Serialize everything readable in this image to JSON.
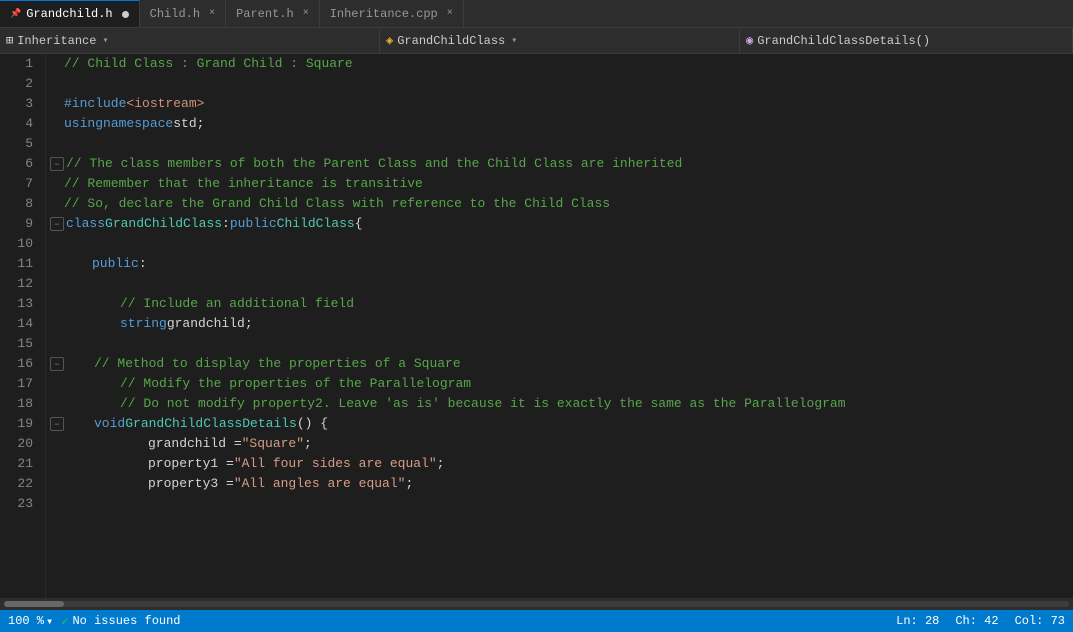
{
  "tabs": [
    {
      "id": "grandchild-h",
      "label": "Grandchild.h",
      "active": true,
      "modified": true,
      "pinned": true
    },
    {
      "id": "child-h",
      "label": "Child.h",
      "active": false,
      "modified": false
    },
    {
      "id": "parent-h",
      "label": "Parent.h",
      "active": false,
      "modified": false
    },
    {
      "id": "inheritance-cpp",
      "label": "Inheritance.cpp",
      "active": false,
      "modified": false
    }
  ],
  "toolbar": {
    "scope_icon": "⊞",
    "scope_label": "Inheritance",
    "class_icon": "◈",
    "class_label": "GrandChildClass",
    "method_icon": "◉",
    "method_label": "GrandChildClassDetails()"
  },
  "lines": [
    {
      "num": 1,
      "indent": 0,
      "collapse": false,
      "content": [
        {
          "cls": "c-comment",
          "text": "// Child Class : Grand Child : Square"
        }
      ]
    },
    {
      "num": 2,
      "indent": 0,
      "collapse": false,
      "content": []
    },
    {
      "num": 3,
      "indent": 0,
      "collapse": false,
      "content": [
        {
          "cls": "c-keyword",
          "text": "#include"
        },
        {
          "cls": "c-default",
          "text": " "
        },
        {
          "cls": "c-include-path",
          "text": "<iostream>"
        }
      ]
    },
    {
      "num": 4,
      "indent": 0,
      "collapse": false,
      "content": [
        {
          "cls": "c-keyword",
          "text": "using"
        },
        {
          "cls": "c-default",
          "text": " "
        },
        {
          "cls": "c-keyword",
          "text": "namespace"
        },
        {
          "cls": "c-default",
          "text": " std;"
        }
      ]
    },
    {
      "num": 5,
      "indent": 0,
      "collapse": false,
      "content": []
    },
    {
      "num": 6,
      "indent": 0,
      "collapse": true,
      "content": [
        {
          "cls": "c-comment",
          "text": "// The class members of both the Parent Class and the Child Class are inherited"
        }
      ]
    },
    {
      "num": 7,
      "indent": 0,
      "collapse": false,
      "content": [
        {
          "cls": "c-comment",
          "text": "// Remember that the inheritance is transitive"
        }
      ]
    },
    {
      "num": 8,
      "indent": 0,
      "collapse": false,
      "content": [
        {
          "cls": "c-comment",
          "text": "// So, declare the Grand Child Class with reference to the Child Class"
        }
      ]
    },
    {
      "num": 9,
      "indent": 0,
      "collapse": true,
      "content": [
        {
          "cls": "c-keyword",
          "text": "class"
        },
        {
          "cls": "c-default",
          "text": " "
        },
        {
          "cls": "c-class-name",
          "text": "GrandChildClass"
        },
        {
          "cls": "c-default",
          "text": " : "
        },
        {
          "cls": "c-keyword",
          "text": "public"
        },
        {
          "cls": "c-default",
          "text": " "
        },
        {
          "cls": "c-class-name",
          "text": "ChildClass"
        },
        {
          "cls": "c-default",
          "text": " {"
        }
      ]
    },
    {
      "num": 10,
      "indent": 0,
      "collapse": false,
      "content": []
    },
    {
      "num": 11,
      "indent": 1,
      "collapse": false,
      "content": [
        {
          "cls": "c-public",
          "text": "public"
        },
        {
          "cls": "c-default",
          "text": ":"
        }
      ]
    },
    {
      "num": 12,
      "indent": 0,
      "collapse": false,
      "content": []
    },
    {
      "num": 13,
      "indent": 2,
      "collapse": false,
      "content": [
        {
          "cls": "c-comment",
          "text": "// Include an additional field"
        }
      ]
    },
    {
      "num": 14,
      "indent": 2,
      "collapse": false,
      "content": [
        {
          "cls": "c-keyword",
          "text": "string"
        },
        {
          "cls": "c-default",
          "text": " grandchild;"
        }
      ]
    },
    {
      "num": 15,
      "indent": 0,
      "collapse": false,
      "content": []
    },
    {
      "num": 16,
      "indent": 1,
      "collapse": true,
      "content": [
        {
          "cls": "c-comment",
          "text": "// Method to display the properties of a Square"
        }
      ]
    },
    {
      "num": 17,
      "indent": 2,
      "collapse": false,
      "content": [
        {
          "cls": "c-comment",
          "text": "// Modify the properties of the Parallelogram"
        }
      ]
    },
    {
      "num": 18,
      "indent": 2,
      "collapse": false,
      "content": [
        {
          "cls": "c-comment",
          "text": "// Do not modify property2. Leave 'as is' because it is exactly the same as the Parallelogram"
        }
      ]
    },
    {
      "num": 19,
      "indent": 1,
      "collapse": true,
      "content": [
        {
          "cls": "c-keyword",
          "text": "void"
        },
        {
          "cls": "c-default",
          "text": " "
        },
        {
          "cls": "c-class-name",
          "text": "GrandChildClassDetails"
        },
        {
          "cls": "c-default",
          "text": "() {"
        }
      ]
    },
    {
      "num": 20,
      "indent": 3,
      "collapse": false,
      "content": [
        {
          "cls": "c-default",
          "text": "grandchild = "
        },
        {
          "cls": "c-string",
          "text": "\"Square\""
        },
        {
          "cls": "c-default",
          "text": ";"
        }
      ]
    },
    {
      "num": 21,
      "indent": 3,
      "collapse": false,
      "content": [
        {
          "cls": "c-default",
          "text": "property1 = "
        },
        {
          "cls": "c-string",
          "text": "\"All four sides are equal\""
        },
        {
          "cls": "c-default",
          "text": ";"
        }
      ]
    },
    {
      "num": 22,
      "indent": 3,
      "collapse": false,
      "content": [
        {
          "cls": "c-default",
          "text": "property3 = "
        },
        {
          "cls": "c-string",
          "text": "\"All angles are equal\""
        },
        {
          "cls": "c-default",
          "text": ";"
        }
      ]
    },
    {
      "num": 23,
      "indent": 0,
      "collapse": false,
      "content": []
    }
  ],
  "status": {
    "zoom": "100 %",
    "zoom_arrow": "▾",
    "no_issues_icon": "✓",
    "no_issues_label": "No issues found",
    "ln": "Ln: 28",
    "ch": "Ch: 42",
    "col": "Col: 73"
  }
}
